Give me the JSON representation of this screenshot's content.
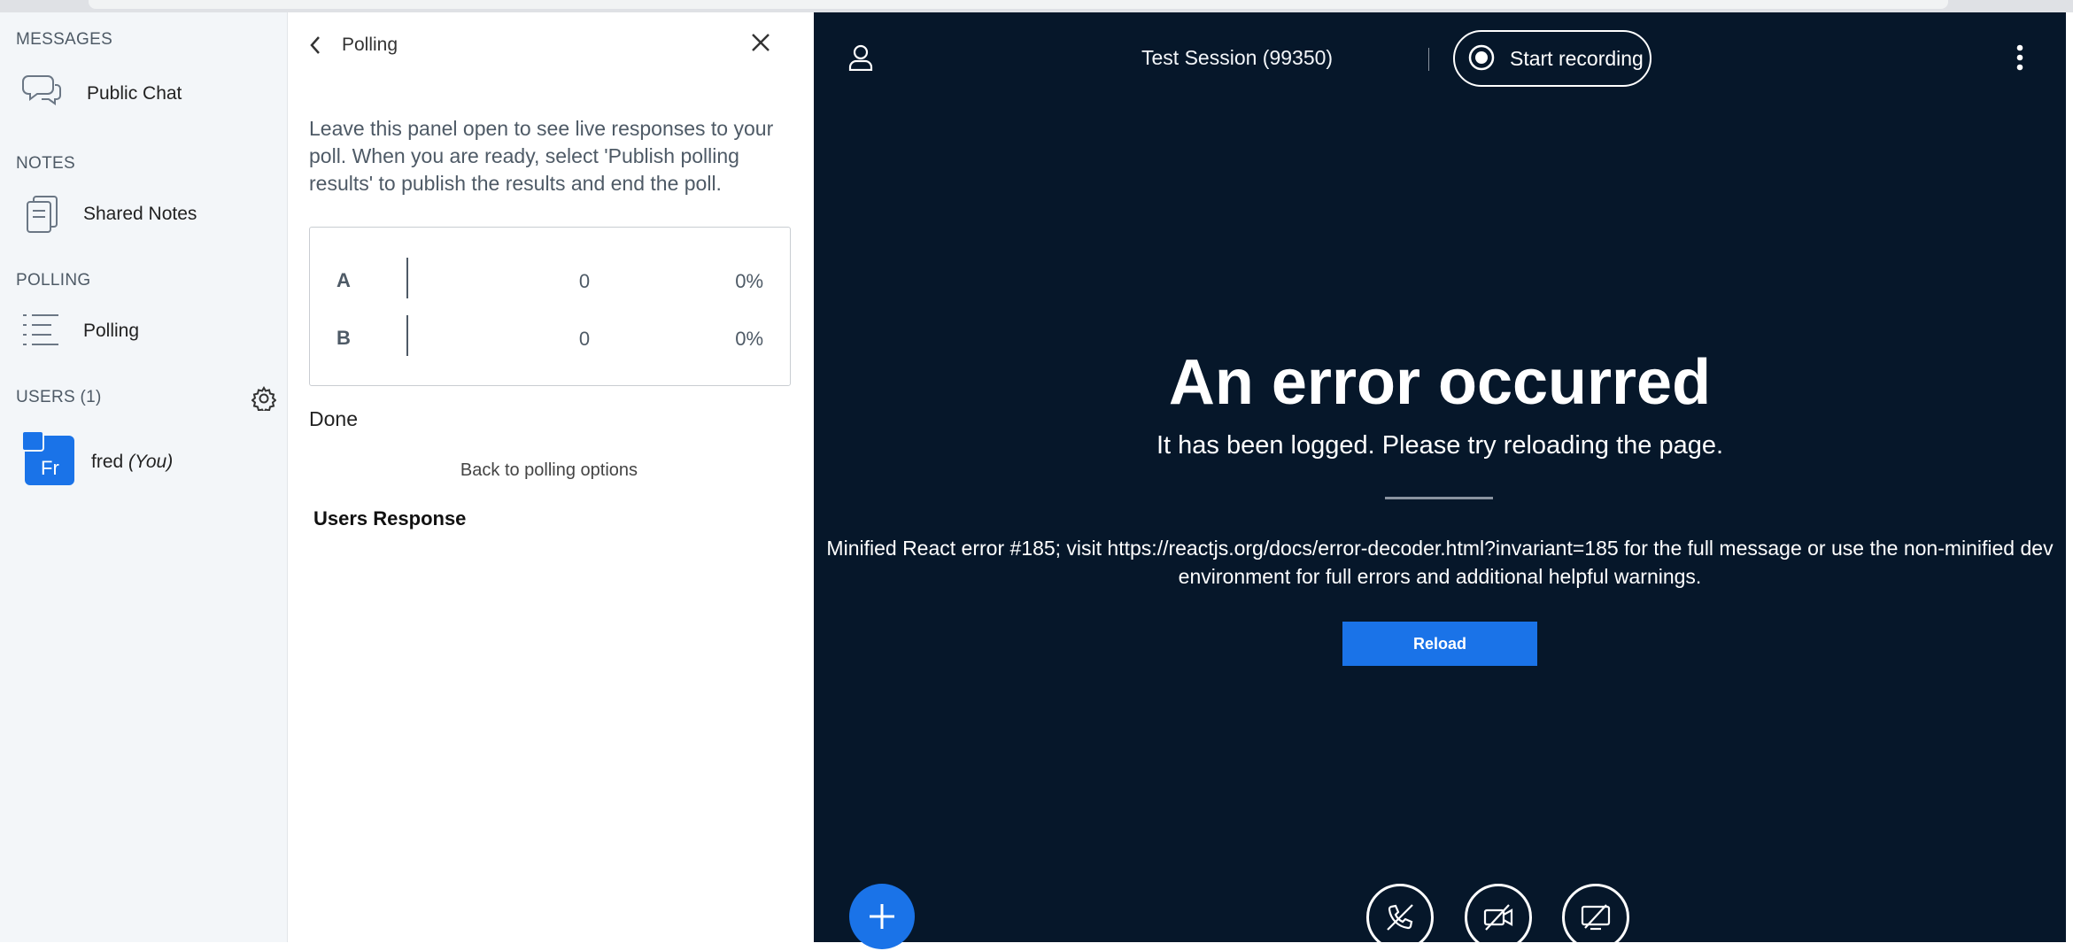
{
  "sidebar": {
    "messages_title": "MESSAGES",
    "public_chat": "Public Chat",
    "notes_title": "NOTES",
    "shared_notes": "Shared Notes",
    "polling_title": "POLLING",
    "polling": "Polling",
    "users_title": "USERS (1)",
    "user": {
      "initials": "Fr",
      "name": "fred",
      "you_label": "(You)"
    }
  },
  "poll_panel": {
    "back_label": "Polling",
    "instructions": "Leave this panel open to see live responses to your poll. When you are ready, select 'Publish polling results' to publish the results and end the poll.",
    "results": [
      {
        "key": "A",
        "count": "0",
        "percent": "0%"
      },
      {
        "key": "B",
        "count": "0",
        "percent": "0%"
      }
    ],
    "done_label": "Done",
    "back_to_options": "Back to polling options",
    "users_response_title": "Users Response"
  },
  "main": {
    "session_title": "Test Session (99350)",
    "record_label": "Start recording",
    "error_title": "An error occurred",
    "error_subtitle": "It has been logged. Please try reloading the page.",
    "error_detail_line1": "Minified React error #185; visit https://reactjs.org/docs/error-decoder.html?invariant=185 for the full message or use the non-minified dev",
    "error_detail_line2": "environment for full errors and additional helpful warnings.",
    "reload_label": "Reload"
  },
  "icons": {
    "chat": "chat-icon",
    "notes": "notes-icon",
    "polling": "list-icon",
    "settings": "gear-icon",
    "user": "user-icon",
    "more": "kebab-icon",
    "add": "plus-icon",
    "audio": "phone-icon",
    "video": "video-off-icon",
    "screenshare": "screenshare-off-icon"
  },
  "colors": {
    "accent": "#1a73e8",
    "main_background": "#06172a",
    "sidebar_background": "#f3f6f9"
  }
}
